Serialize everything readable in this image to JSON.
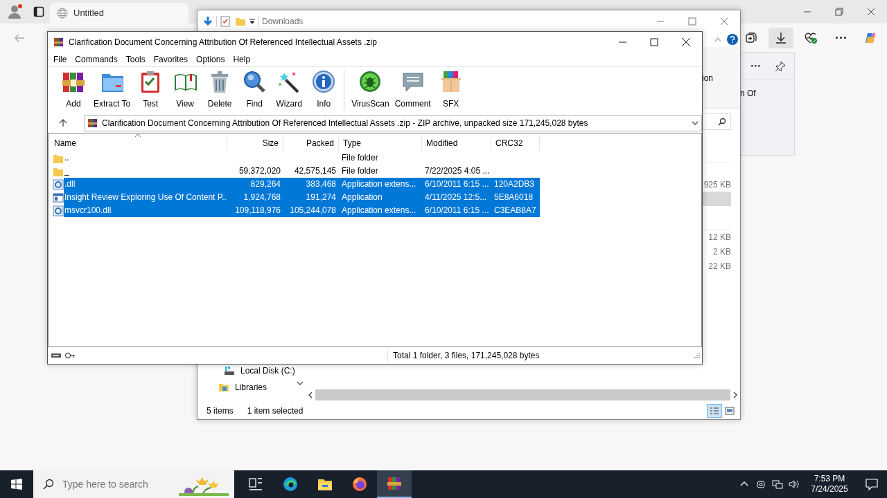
{
  "browser": {
    "tab": {
      "title": "Untitled",
      "selected": true
    },
    "flyout_text": "n Of"
  },
  "explorer": {
    "title": "Downloads",
    "ribbon_text": "ion",
    "rows": [
      {
        "size": "925 KB",
        "selected": false,
        "group_start": false
      },
      {
        "selected": true,
        "group_start": false
      },
      {
        "size": "12 KB",
        "selected": false,
        "group_start": true
      },
      {
        "size": "2 KB",
        "selected": false,
        "group_start": false
      },
      {
        "size": "22 KB",
        "selected": false,
        "group_start": false
      }
    ],
    "nav_items": [
      {
        "label": "Local Disk (C:)",
        "kind": "drive"
      },
      {
        "label": "Libraries",
        "kind": "library"
      }
    ],
    "status_count": "5 items",
    "status_selected": "1 item selected"
  },
  "winrar": {
    "title": "Clarification Document Concerning Attribution Of Referenced Intellectual Assets  .zip",
    "menu": [
      "File",
      "Commands",
      "Tools",
      "Favorites",
      "Options",
      "Help"
    ],
    "toolbar": [
      {
        "label": "Add",
        "kind": "add",
        "separator_before": false
      },
      {
        "label": "Extract To",
        "kind": "extract",
        "separator_before": false
      },
      {
        "label": "Test",
        "kind": "test",
        "separator_before": false
      },
      {
        "label": "View",
        "kind": "view",
        "separator_before": false
      },
      {
        "label": "Delete",
        "kind": "delete",
        "separator_before": false
      },
      {
        "label": "Find",
        "kind": "find",
        "separator_before": false
      },
      {
        "label": "Wizard",
        "kind": "wizard",
        "separator_before": false
      },
      {
        "label": "Info",
        "kind": "info",
        "separator_before": false
      },
      {
        "label": "VirusScan",
        "kind": "virusscan",
        "separator_before": true
      },
      {
        "label": "Comment",
        "kind": "comment",
        "separator_before": false
      },
      {
        "label": "SFX",
        "kind": "sfx",
        "separator_before": false
      }
    ],
    "address": "Clarification Document Concerning Attribution Of Referenced Intellectual Assets  .zip - ZIP archive, unpacked size 171,245,028 bytes",
    "columns": [
      "Name",
      "Size",
      "Packed",
      "Type",
      "Modified",
      "CRC32"
    ],
    "rows": [
      {
        "kind": "folder",
        "name": "..",
        "type": "File folder",
        "selected": false
      },
      {
        "kind": "folder",
        "name": "_",
        "size": "59,372,020",
        "packed": "42,575,145",
        "type": "File folder",
        "modified": "7/22/2025 4:05 ...",
        "selected": false
      },
      {
        "kind": "dll",
        "name": ".dll",
        "size": "829,264",
        "packed": "383,468",
        "type": "Application extens...",
        "modified": "6/10/2011 6:15 ...",
        "crc": "120A2DB3",
        "selected": true
      },
      {
        "kind": "exe",
        "name": "Insight Review Exploring Use Of Content P...",
        "size": "1,924,768",
        "packed": "191,274",
        "type": "Application",
        "modified": "4/11/2025 12:5...",
        "crc": "5E8A6018",
        "selected": true
      },
      {
        "kind": "dll",
        "name": "msvcr100.dll",
        "size": "109,118,976",
        "packed": "105,244,078",
        "type": "Application extens...",
        "modified": "6/10/2011 6:15 ...",
        "crc": "C3EAB8A7",
        "selected": true
      }
    ],
    "status": "Total 1 folder, 3 files, 171,245,028 bytes"
  },
  "taskbar": {
    "search_placeholder": "Type here to search",
    "apps": [
      {
        "kind": "taskview",
        "selected": false
      },
      {
        "kind": "edge",
        "selected": false
      },
      {
        "kind": "explorer",
        "selected": false
      },
      {
        "kind": "firefox",
        "selected": false
      },
      {
        "kind": "winrar",
        "selected": true
      }
    ],
    "time": "7:53 PM",
    "date": "7/24/2025"
  }
}
